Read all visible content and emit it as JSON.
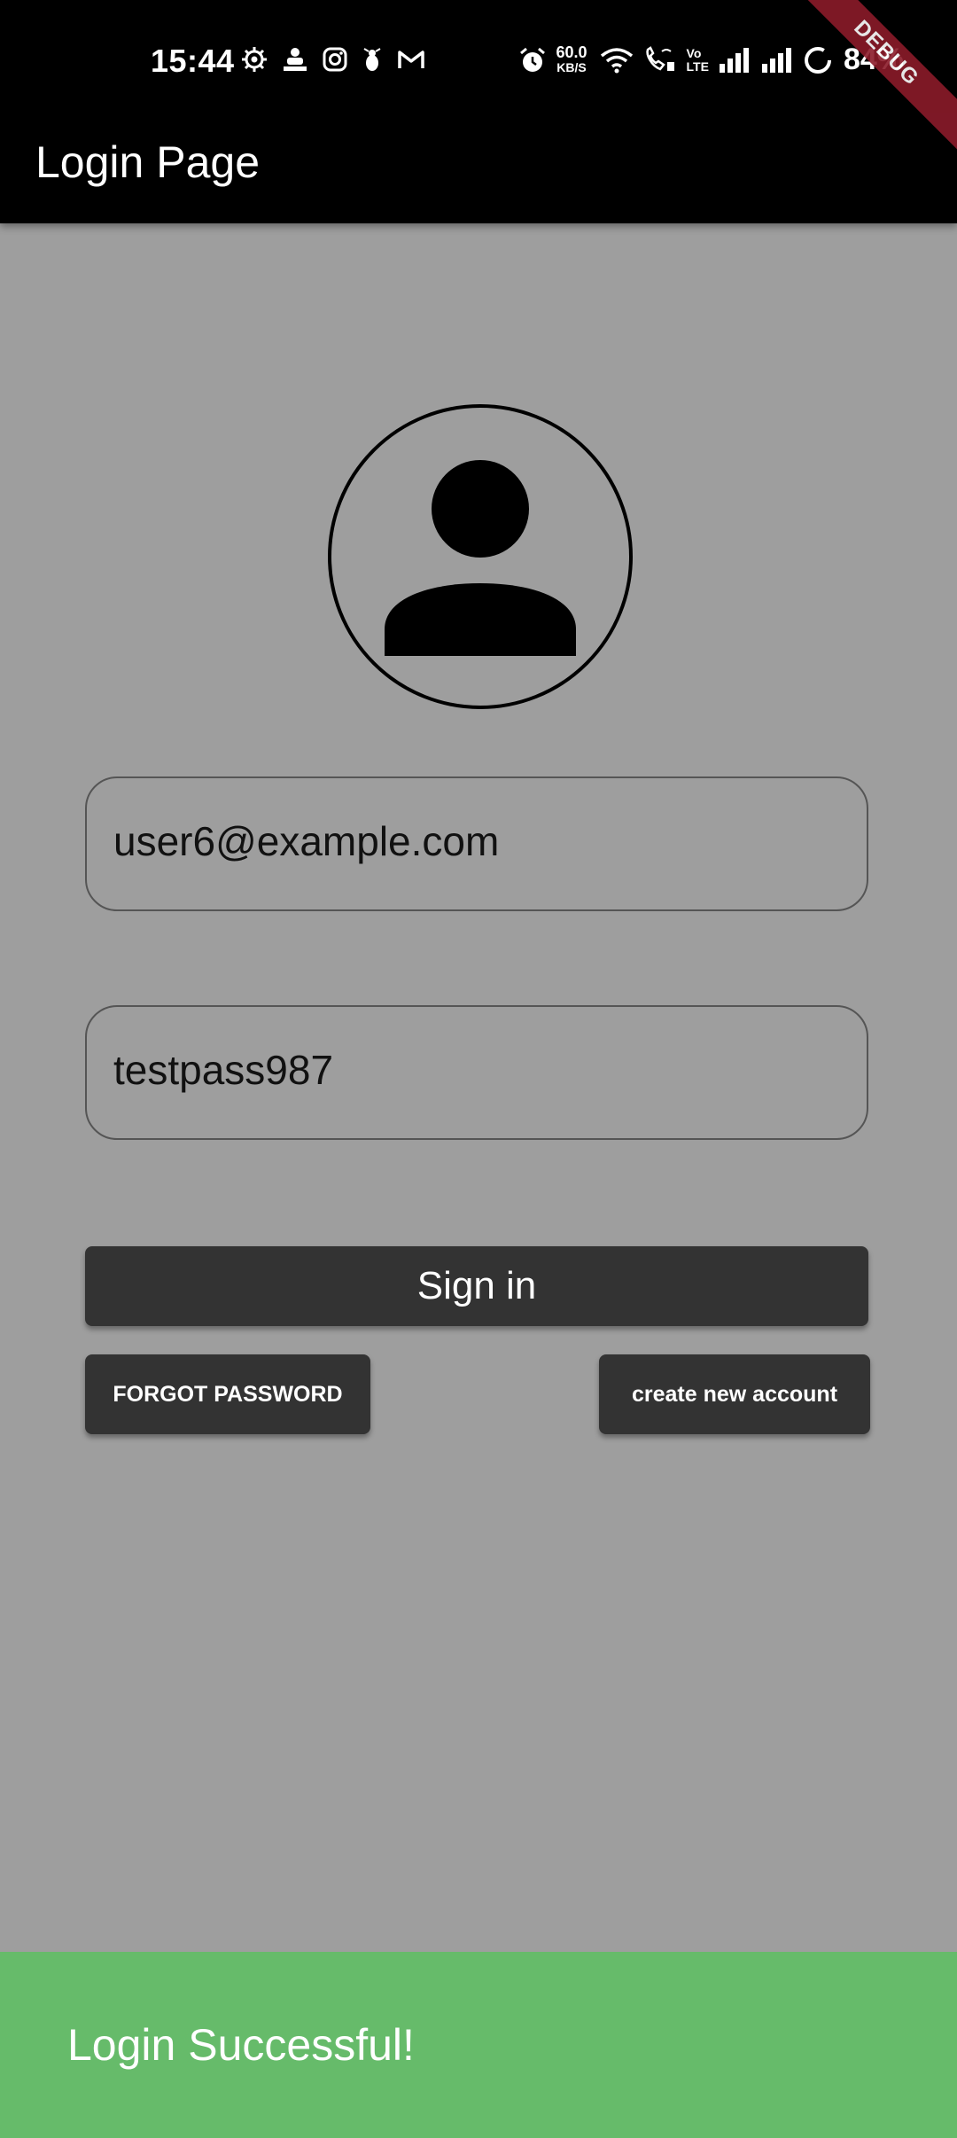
{
  "status_bar": {
    "time": "15:44",
    "net_speed_value": "60.0",
    "net_speed_unit": "KB/S",
    "volte_top": "Vo",
    "volte_bottom": "LTE",
    "battery": "84%",
    "left_icons": [
      "settings-gear-icon",
      "notification-app-icon",
      "instagram-icon",
      "notification-bug-icon",
      "gmail-icon"
    ],
    "right_icons": [
      "alarm-icon",
      "wifi-icon",
      "wifi-call-icon",
      "signal-icon",
      "signal-icon-2",
      "battery-ring-icon"
    ]
  },
  "debug_banner": "DEBUG",
  "app_bar": {
    "title": "Login Page"
  },
  "avatar": {
    "icon": "account-circle-icon"
  },
  "form": {
    "email_value": "user6@example.com",
    "password_value": "testpass987"
  },
  "buttons": {
    "sign_in": "Sign in",
    "forgot_password": "FORGOT PASSWORD",
    "create_account": "create new account"
  },
  "snackbar": {
    "message": "Login Successful!",
    "color": "#66bb6a"
  },
  "colors": {
    "background": "#9e9e9e",
    "app_bar": "#000000",
    "button": "#333333"
  }
}
